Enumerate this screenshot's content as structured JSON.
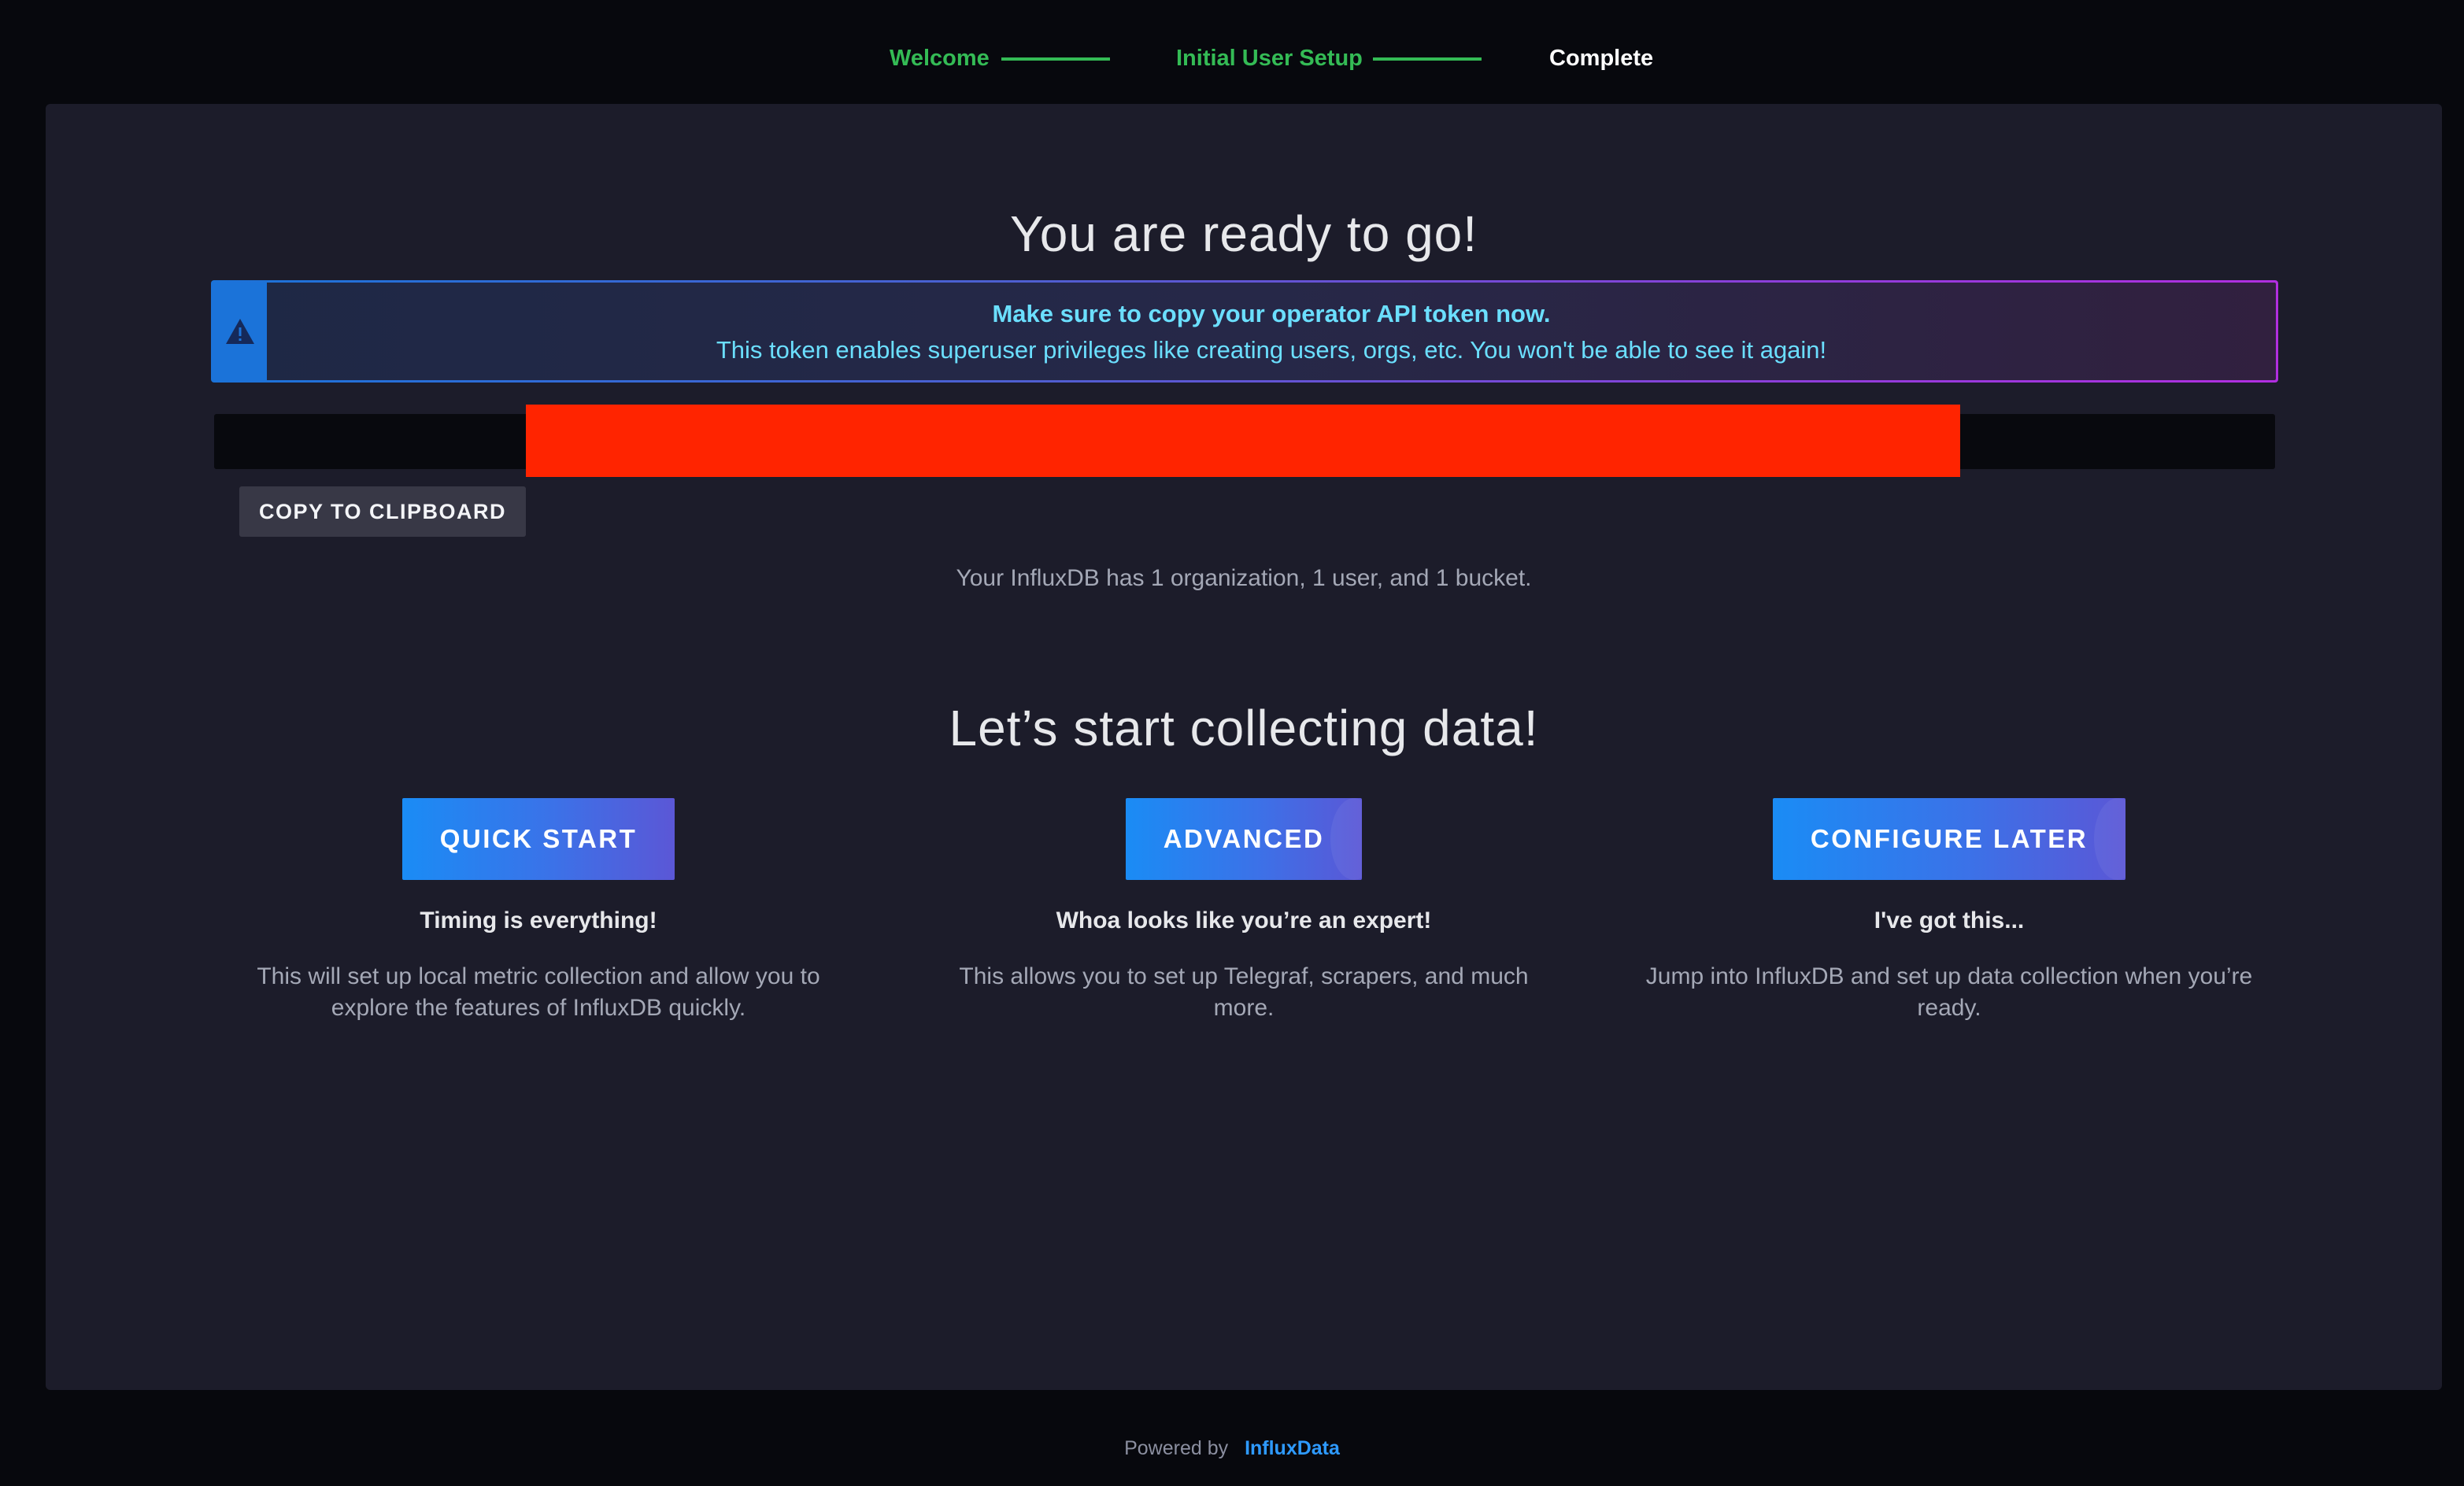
{
  "steps": [
    {
      "label": "Welcome",
      "state": "done"
    },
    {
      "label": "Initial User Setup",
      "state": "done"
    },
    {
      "label": "Complete",
      "state": "current"
    }
  ],
  "colors": {
    "step_done": "#34bb55",
    "step_current": "#ffffff",
    "primary": "#1a8cf5",
    "alert_text": "#6bdfff",
    "redaction": "#ff2400"
  },
  "main": {
    "headline": "You are ready to go!",
    "alert": {
      "icon": "warning-icon",
      "title": "Make sure to copy your operator API token now.",
      "body": "This token enables superuser privileges like creating users, orgs, etc. You won't be able to see it again!"
    },
    "copy_button": "COPY TO CLIPBOARD",
    "summary": "Your InfluxDB has 1 organization, 1 user, and 1 bucket.",
    "collect_heading": "Let’s start collecting data!",
    "options": [
      {
        "button": "QUICK START",
        "title": "Timing is everything!",
        "description": "This will set up local metric collection and allow you to explore the features of InfluxDB quickly."
      },
      {
        "button": "ADVANCED",
        "title": "Whoa looks like you’re an expert!",
        "description": "This allows you to set up Telegraf, scrapers, and much more."
      },
      {
        "button": "CONFIGURE LATER",
        "title": "I've got this...",
        "description": "Jump into InfluxDB and set up data collection when you’re ready."
      }
    ]
  },
  "footer": {
    "powered_by": "Powered by",
    "brand": "InfluxData"
  }
}
